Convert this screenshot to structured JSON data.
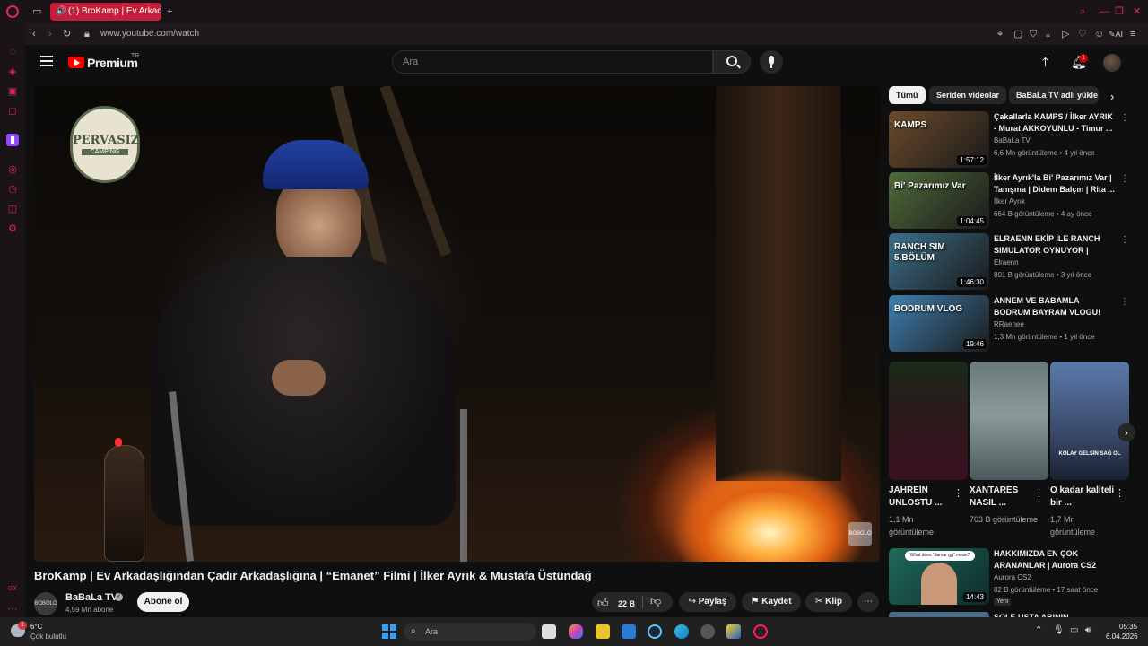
{
  "browser": {
    "tab_title": "(1) BroKamp | Ev Arkada",
    "url": "www.youtube.com/watch",
    "ai_label": "AI"
  },
  "header": {
    "logo_text": "Premium",
    "logo_sup": "TR",
    "search_placeholder": "Ara",
    "notification_count": "1"
  },
  "video": {
    "title": "BroKamp | Ev Arkadaşlığından Çadır Arkadaşlığına | “Emanet” Filmi | İlker Ayrık & Mustafa Üstündağ",
    "logo_line1": "PERVASIZ",
    "logo_line2": "CAMPING",
    "watermark": "BOBOLO"
  },
  "channel": {
    "name": "BaBaLa TV",
    "subscribers": "4,59 Mn abone",
    "avatar_text": "BOBOLO",
    "subscribe_label": "Abone ol"
  },
  "actions": {
    "likes": "22 B",
    "share": "Paylaş",
    "save": "Kaydet",
    "clip": "Klip"
  },
  "chips": [
    "Tümü",
    "Seriden videolar",
    "BaBaLa TV adlı yükle"
  ],
  "recommendations": [
    {
      "title": "Çakallarla KAMPS / İlker AYRIK - Murat AKKOYUNLU - Timur ...",
      "channel": "BaBaLa TV",
      "meta": "6,6 Mn görüntüleme • 4 yıl önce",
      "duration": "1:57:12",
      "thumb_text": "KAMPS",
      "thumb_color": "#6b4a2a"
    },
    {
      "title": "İlker Ayrık'la Bi' Pazarımız Var | Tanışma | Didem Balçın | Rita ...",
      "channel": "İlker Ayrık",
      "meta": "664 B görüntüleme • 4 ay önce",
      "duration": "1:04:45",
      "thumb_text": "Bi' Pazarımız Var",
      "thumb_color": "#4f6a3a"
    },
    {
      "title": "ELRAENN EKİP İLE RANCH SIMULATOR OYNUYOR | TEMİ...",
      "channel": "Elraenn",
      "meta": "801 B görüntüleme • 3 yıl önce",
      "duration": "1:46:30",
      "thumb_text": "RANCH SIM 5.BÖLÜM",
      "thumb_color": "#3a6f8a"
    },
    {
      "title": "ANNEM VE BABAMLA BODRUM BAYRAM VLOGU!",
      "channel": "RRaenee",
      "meta": "1,3 Mn görüntüleme • 1 yıl önce",
      "duration": "19:46",
      "thumb_text": "BODRUM VLOG",
      "thumb_color": "#3f7fb0"
    }
  ],
  "shorts": [
    {
      "title": "JAHREİN UNLOSTU ...",
      "views": "1,1 Mn görüntüleme",
      "color": "#2a1a1a"
    },
    {
      "title": "XANTARES NASIL ...",
      "views": "703 B görüntüleme",
      "color": "#5a6a6a"
    },
    {
      "title": "O kadar kaliteli bir ...",
      "views": "1,7 Mn görüntüleme",
      "color": "#3a4a6a",
      "caption": "KOLAY GELSİN SAĞ OL"
    }
  ],
  "reco_bottom": {
    "title": "HAKKIMIZDA EN ÇOK ARANANLAR | Aurora CS2",
    "channel": "Aurora CS2",
    "meta": "82 B görüntüleme • 17 saat önce",
    "badge": "Yeni",
    "duration": "14:43",
    "bubble": "What does \"damar gg\" mean?"
  },
  "reco_partial_title": "SOLE USTA ABININ",
  "taskbar": {
    "temperature": "6°C",
    "weather": "Çok bulutlu",
    "weather_badge": "1",
    "search": "Ara",
    "time": "05:35",
    "date": "6.04.2026"
  }
}
